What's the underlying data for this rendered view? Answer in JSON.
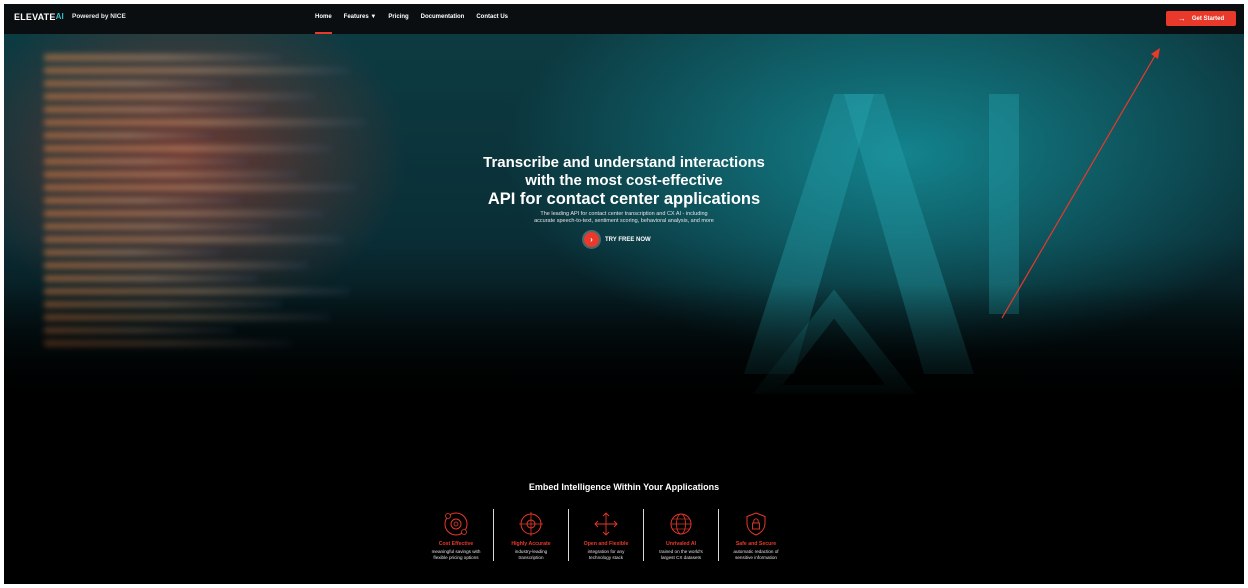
{
  "nav": {
    "logo": "ELEVATE",
    "logo_ai": "AI",
    "powered": "Powered by NICE",
    "menu": [
      "Home",
      "Features",
      "Pricing",
      "Documentation",
      "Contact Us"
    ],
    "cta": "Get Started"
  },
  "hero": {
    "line1": "Transcribe and understand interactions",
    "line2": "with the most cost-effective",
    "line3": "API for contact center applications",
    "sub1": "The leading API for contact center transcription and CX AI - including",
    "sub2": "accurate speech-to-text, sentiment scoring, behavioral analysis, and more",
    "try": "TRY FREE NOW"
  },
  "section": {
    "title": "Embed Intelligence Within Your Applications",
    "features": [
      {
        "title": "Cost Effective",
        "d1": "meaningful savings with",
        "d2": "flexible pricing options",
        "icon": "gear-cycle-icon"
      },
      {
        "title": "Highly Accurate",
        "d1": "industry-leading",
        "d2": "transcription",
        "icon": "target-icon"
      },
      {
        "title": "Open and Flexible",
        "d1": "integration for any",
        "d2": "technology stack",
        "icon": "arrows-expand-icon"
      },
      {
        "title": "Unrivaled AI",
        "d1": "trained on the world's",
        "d2": "largest CX datasets",
        "icon": "globe-icon"
      },
      {
        "title": "Safe and Secure",
        "d1": "automatic redaction of",
        "d2": "sensitive information",
        "icon": "shield-lock-icon"
      }
    ]
  },
  "colors": {
    "accent": "#e8392a",
    "teal": "#36c0c8"
  }
}
